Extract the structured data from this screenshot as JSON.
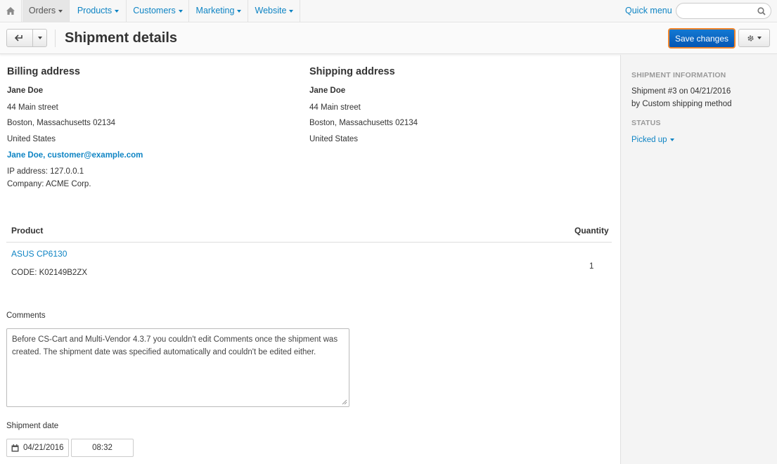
{
  "nav": {
    "items": [
      {
        "label": "Orders"
      },
      {
        "label": "Products"
      },
      {
        "label": "Customers"
      },
      {
        "label": "Marketing"
      },
      {
        "label": "Website"
      }
    ],
    "quick_menu": "Quick menu",
    "search_placeholder": ""
  },
  "toolbar": {
    "title": "Shipment details",
    "save_label": "Save changes"
  },
  "billing": {
    "heading": "Billing address",
    "name": "Jane Doe",
    "street": "44 Main street",
    "city_line": "Boston, Massachusetts 02134",
    "country": "United States",
    "customer_name": "Jane Doe",
    "customer_email": "customer@example.com",
    "ip": "IP address: 127.0.0.1",
    "company": "Company: ACME Corp."
  },
  "shipping": {
    "heading": "Shipping address",
    "name": "Jane Doe",
    "street": "44 Main street",
    "city_line": "Boston, Massachusetts 02134",
    "country": "United States"
  },
  "products": {
    "columns": [
      "Product",
      "Quantity"
    ],
    "rows": [
      {
        "name": "ASUS CP6130",
        "code": "CODE: K02149B2ZX",
        "quantity": "1"
      }
    ]
  },
  "comments": {
    "label": "Comments",
    "value": "Before CS-Cart and Multi-Vendor 4.3.7 you couldn't edit Comments once the shipment was created. The shipment date was specified automatically and couldn't be edited either."
  },
  "shipment_date": {
    "label": "Shipment date",
    "date": "04/21/2016",
    "time": "08:32"
  },
  "sidebar": {
    "info_heading": "SHIPMENT INFORMATION",
    "info_line1": "Shipment #3 on 04/21/2016",
    "info_line2": "by Custom shipping method",
    "status_heading": "STATUS",
    "status_value": "Picked up"
  },
  "colors": {
    "link": "#0e84c4",
    "primary_button": "#0a66c2",
    "focus_outline": "#f0862d"
  }
}
